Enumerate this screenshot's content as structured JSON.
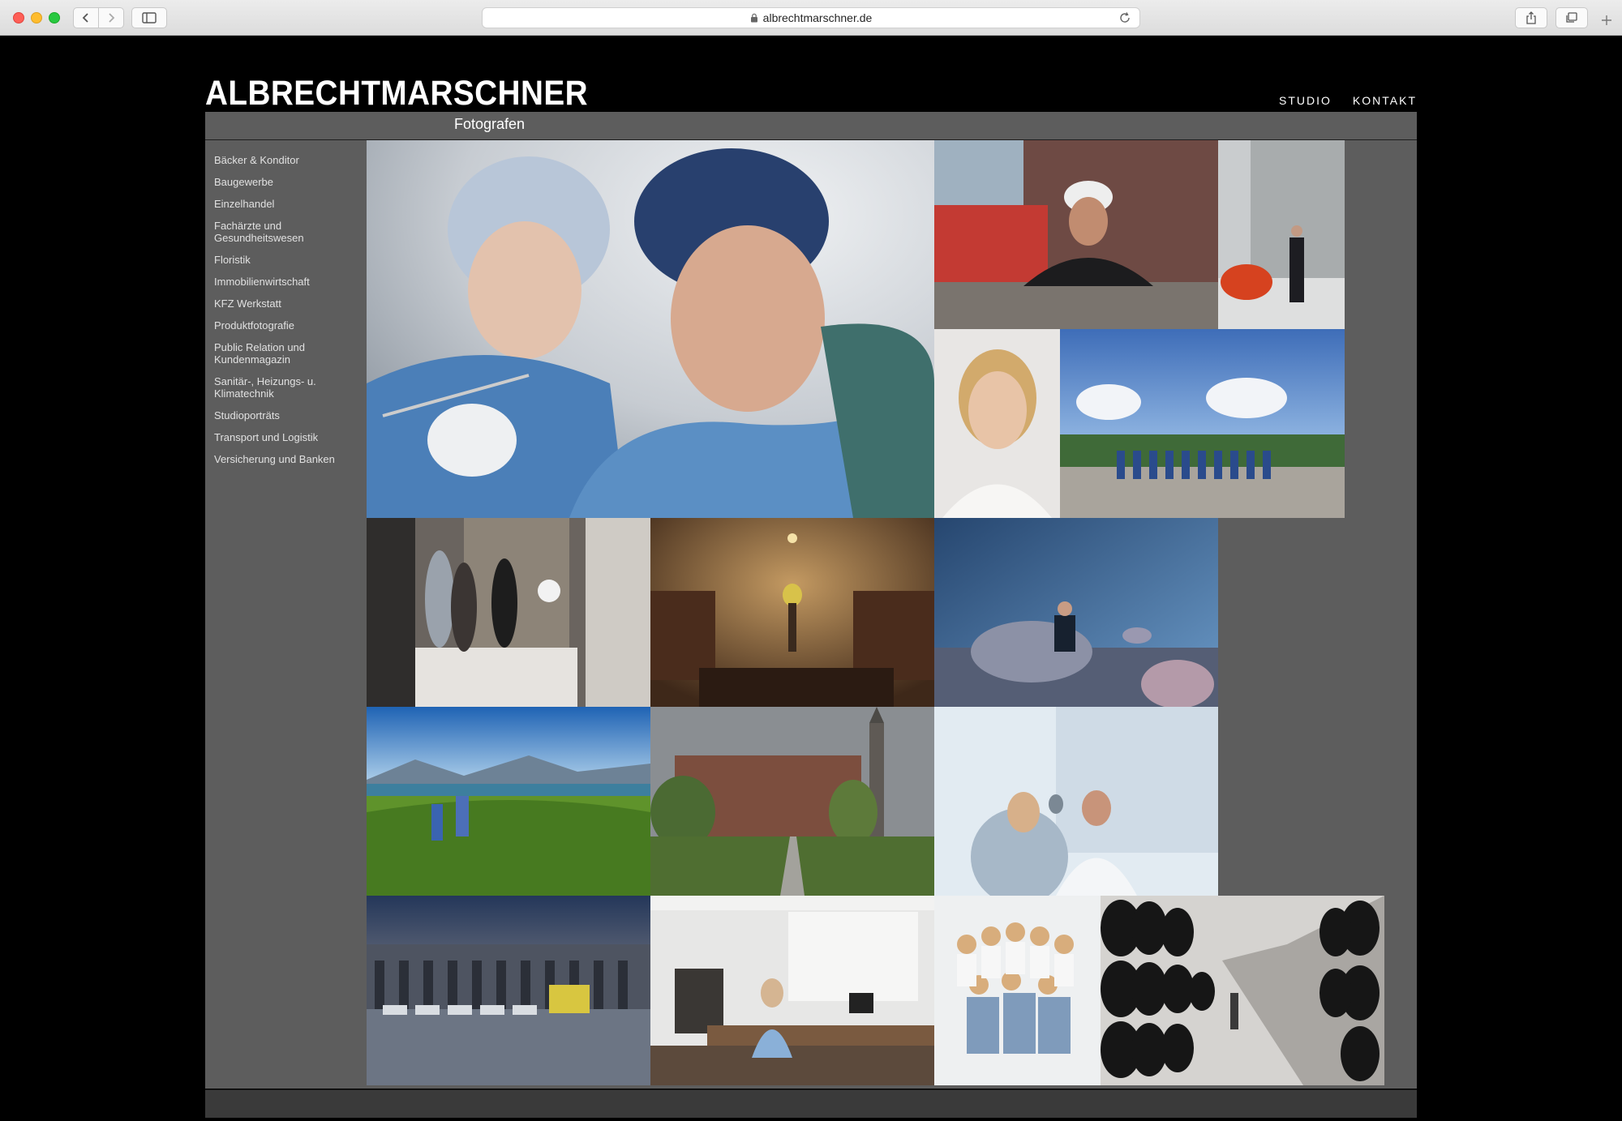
{
  "browser": {
    "url": "albrechtmarschner.de"
  },
  "site": {
    "logo": "ALBRECHTMARSCHNER",
    "subtitle": "Fotografen",
    "nav": [
      {
        "label": "STUDIO"
      },
      {
        "label": "KONTAKT"
      }
    ]
  },
  "sidebar": {
    "items": [
      {
        "label": "Bäcker & Konditor"
      },
      {
        "label": "Baugewerbe"
      },
      {
        "label": "Einzelhandel"
      },
      {
        "label": "Fachärzte und Gesundheitswesen"
      },
      {
        "label": "Floristik"
      },
      {
        "label": "Immobilienwirtschaft"
      },
      {
        "label": "KFZ Werkstatt"
      },
      {
        "label": "Produktfotografie"
      },
      {
        "label": "Public Relation und Kundenmagazin"
      },
      {
        "label": "Sanitär-, Heizungs- u. Klimatechnik"
      },
      {
        "label": "Studioporträts"
      },
      {
        "label": "Transport und Logistik"
      },
      {
        "label": "Versicherung und Banken"
      }
    ]
  },
  "colors": {
    "page_background": "#000000",
    "content_background": "#5d5d5d",
    "text": "#ffffff",
    "sidebar_text": "#e1e1e1"
  }
}
